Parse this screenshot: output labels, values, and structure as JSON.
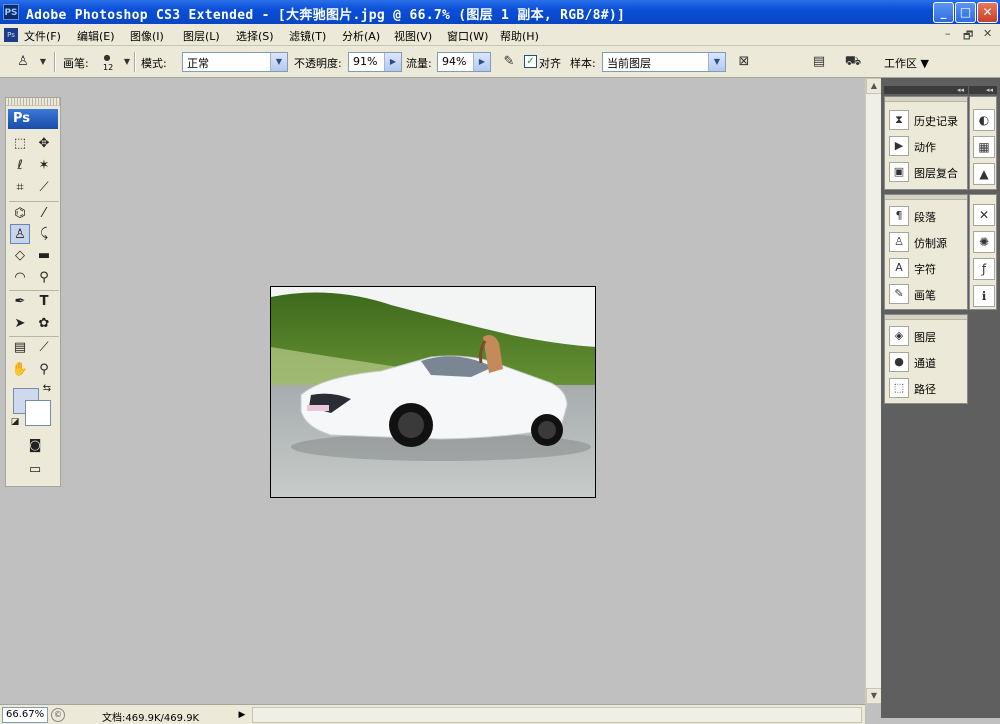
{
  "window": {
    "app_icon": "PS",
    "title": "Adobe Photoshop CS3 Extended - [大奔驰图片.jpg @ 66.7% (图层 1 副本, RGB/8#)]",
    "buttons": {
      "minimize": "_",
      "maximize": "□",
      "close": "✕"
    }
  },
  "menubar": {
    "items": [
      "文件(F)",
      "编辑(E)",
      "图像(I)",
      "图层(L)",
      "选择(S)",
      "滤镜(T)",
      "分析(A)",
      "视图(V)",
      "窗口(W)",
      "帮助(H)"
    ],
    "doc_controls": [
      "–",
      "🗗",
      "✕"
    ]
  },
  "options_bar": {
    "brush_label": "画笔:",
    "brush_size": "12",
    "mode_label": "模式:",
    "mode_value": "正常",
    "opacity_label": "不透明度:",
    "opacity_value": "91%",
    "flow_label": "流量:",
    "flow_value": "94%",
    "aligned_label": "对齐",
    "aligned_checked": true,
    "sample_label": "样本:",
    "sample_value": "当前图层",
    "workspace_label": "工作区 ▼"
  },
  "toolbox": {
    "badge": "Ps"
  },
  "panels": {
    "group1": [
      "历史记录",
      "动作",
      "图层复合"
    ],
    "group2": [
      "段落",
      "仿制源",
      "字符",
      "画笔"
    ],
    "group3": [
      "图层",
      "通道",
      "路径"
    ]
  },
  "statusbar": {
    "zoom": "66.67%",
    "doc_info": "文档:469.9K/469.9K"
  },
  "colors": {
    "titlebar": "#0a4fd8",
    "chrome": "#ece9d8",
    "workspace": "#c0c0c0",
    "foreground_color": "#cfd9ee",
    "background_color": "#ffffff"
  }
}
